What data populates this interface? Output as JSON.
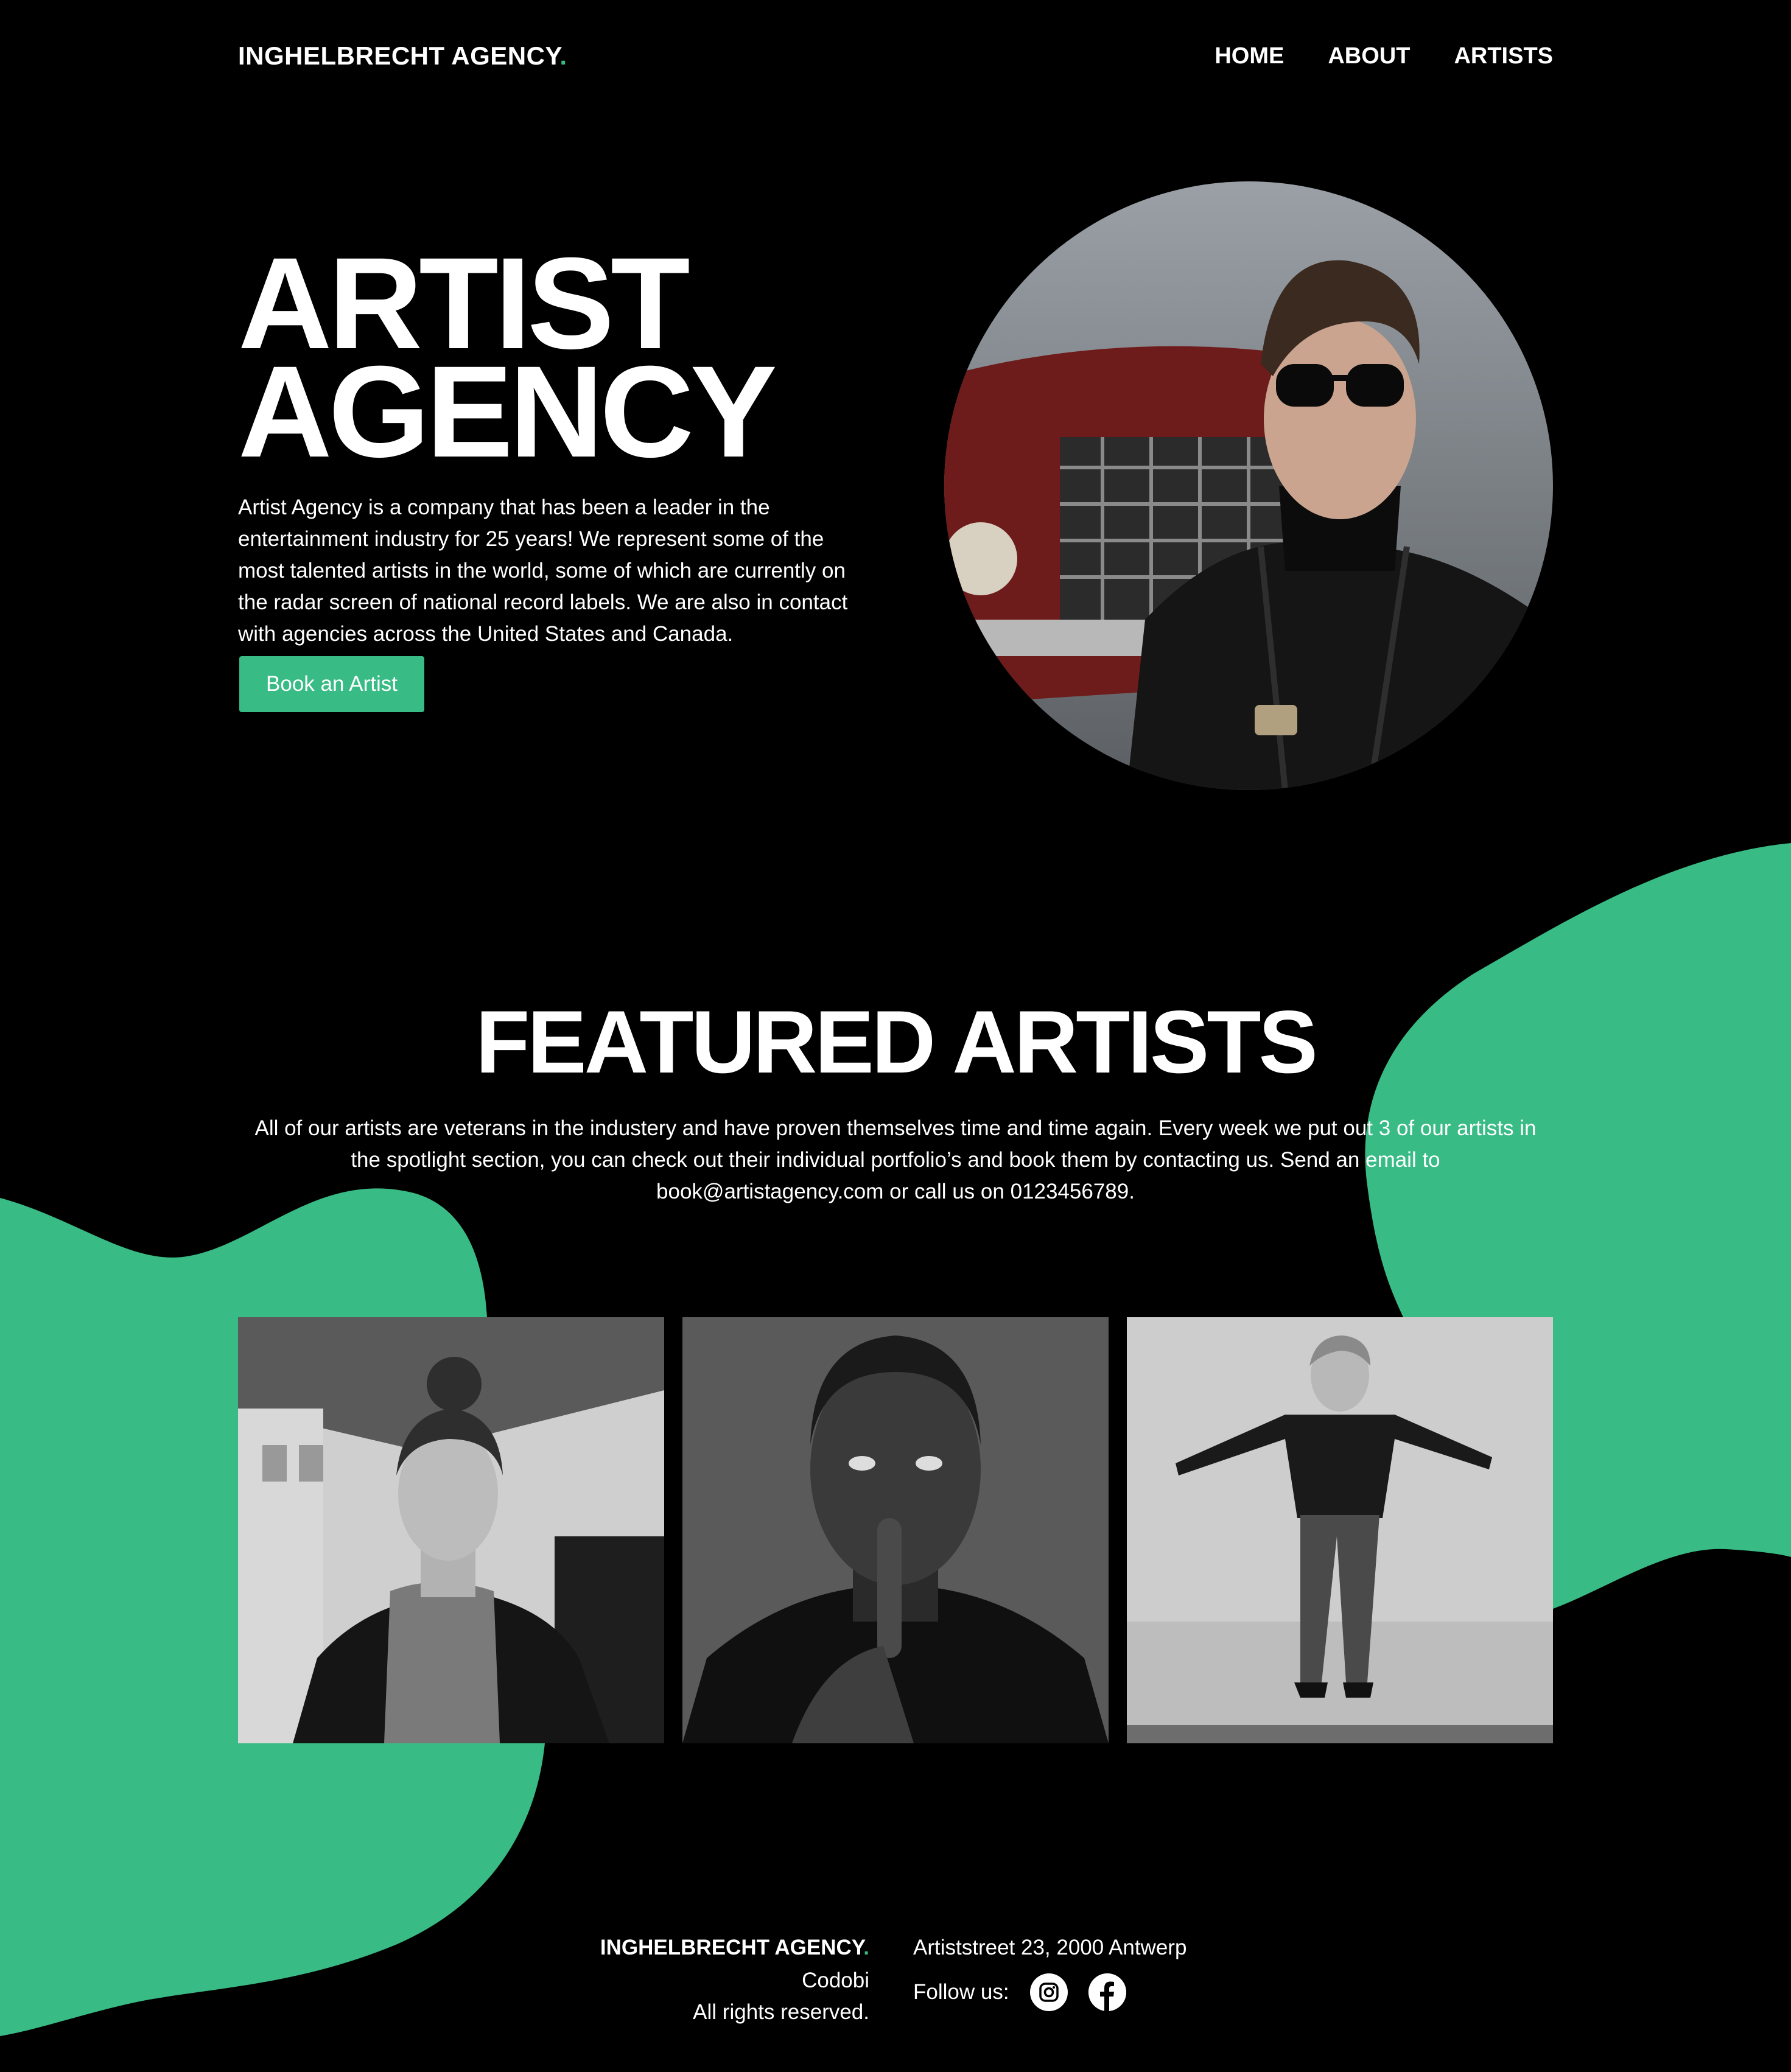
{
  "brand": {
    "name": "INGHELBRECHT AGENCY",
    "dot": ".",
    "accent_color": "#38bb84"
  },
  "nav": {
    "items": [
      {
        "label": "HOME"
      },
      {
        "label": "ABOUT"
      },
      {
        "label": "ARTISTS"
      }
    ]
  },
  "hero": {
    "title_line1": "ARTIST",
    "title_line2": "AGENCY",
    "description": "Artist Agency is a company that has been a leader in the entertainment industry for 25 years! We represent some of the most talented artists in the world, some of which are currently on the radar screen of national record labels. We are also in contact with agencies across the United States and Canada.",
    "cta_label": "Book an Artist"
  },
  "featured": {
    "title": "FEATURED ARTISTS",
    "description": "All of our artists are veterans in the industery and have proven themselves time and time again. Every week we put out 3 of our artists in the spotlight section, you can check out their individual portfolio’s and book them by contacting us. Send an email to book@artistagency.com or call us on 0123456789."
  },
  "footer": {
    "company": "Codobi",
    "rights": "All rights reserved.",
    "address": "Artiststreet 23, 2000 Antwerp",
    "follow_label": "Follow us:",
    "social_icons": [
      "instagram-icon",
      "facebook-icon"
    ]
  }
}
